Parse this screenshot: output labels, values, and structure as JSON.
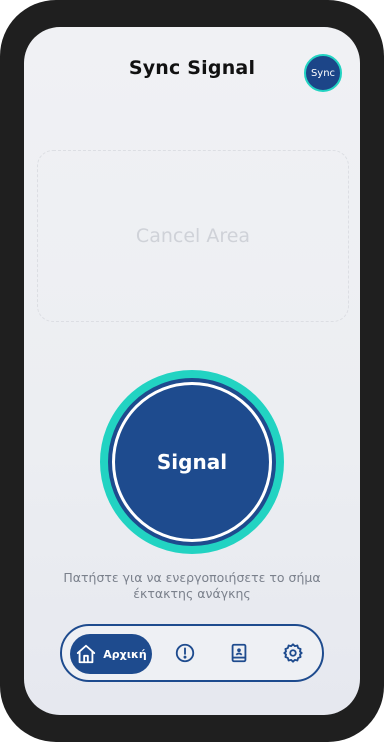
{
  "header": {
    "title": "Sync Signal",
    "avatar_label": "Sync"
  },
  "cancel_area": {
    "label": "Cancel Area"
  },
  "signal_button": {
    "label": "Signal"
  },
  "hint": {
    "text": "Πατήστε για να ενεργοποιήσετε το σήμα έκτακτης ανάγκης"
  },
  "nav": {
    "home_label": "Αρχική",
    "items": [
      {
        "icon": "home-icon"
      },
      {
        "icon": "alert-icon"
      },
      {
        "icon": "book-icon"
      },
      {
        "icon": "gear-icon"
      }
    ]
  },
  "colors": {
    "primary": "#1e4b8e",
    "accent": "#22d3c2",
    "background": "#eceef2"
  }
}
